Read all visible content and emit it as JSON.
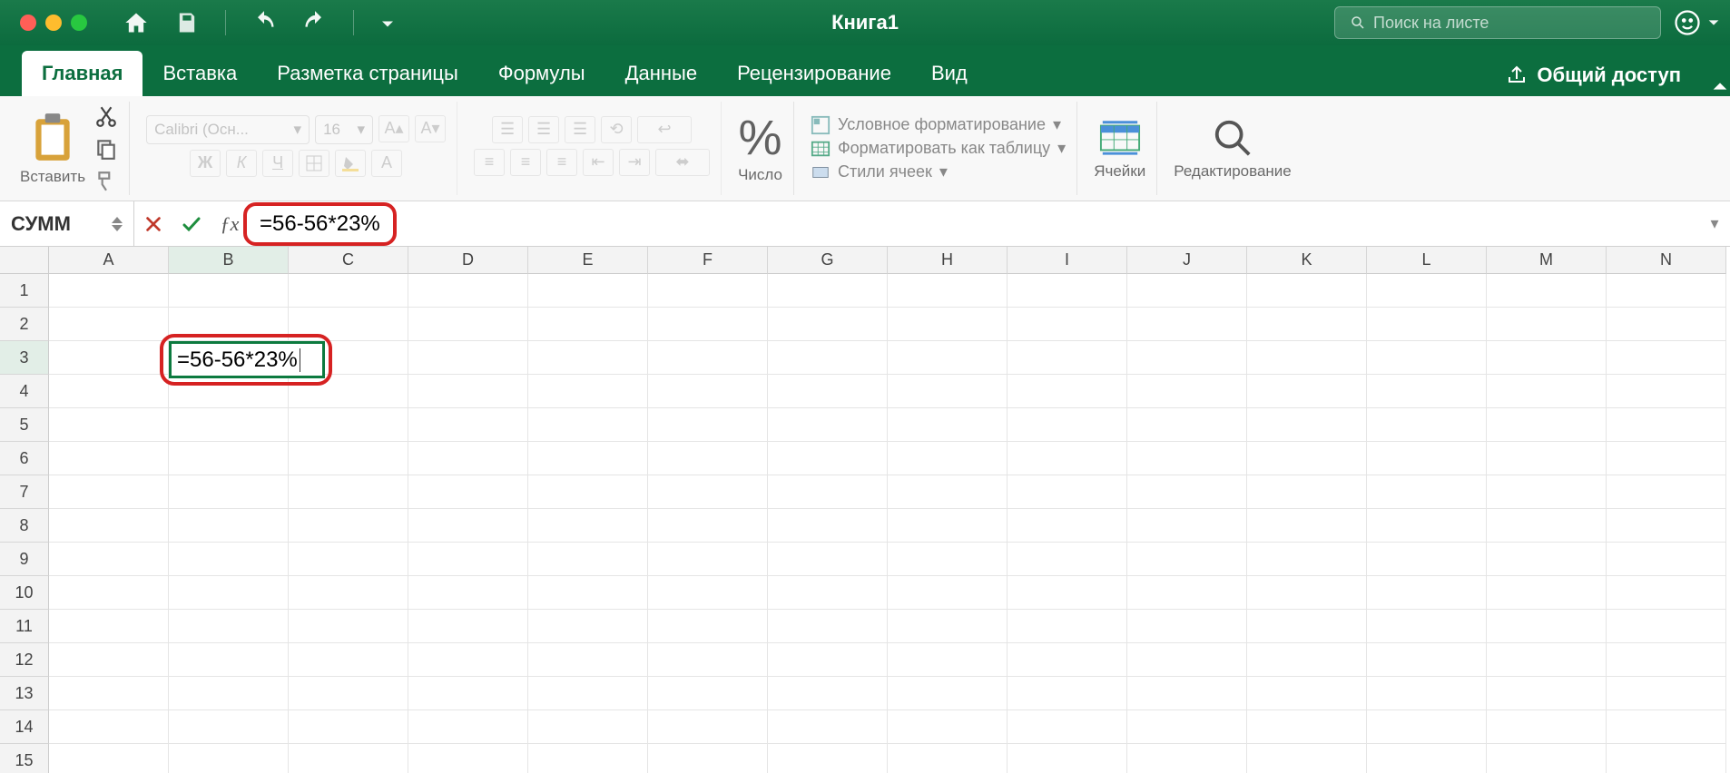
{
  "window": {
    "title": "Книга1"
  },
  "search": {
    "placeholder": "Поиск на листе"
  },
  "tabs": {
    "items": [
      "Главная",
      "Вставка",
      "Разметка страницы",
      "Формулы",
      "Данные",
      "Рецензирование",
      "Вид"
    ],
    "active": 0,
    "share": "Общий доступ"
  },
  "ribbon": {
    "paste": "Вставить",
    "font_name": "Calibri (Осн...",
    "font_size": "16",
    "bold": "Ж",
    "italic": "К",
    "underline": "Ч",
    "number_group": "Число",
    "cond_format": "Условное форматирование",
    "format_table": "Форматировать как таблицу",
    "cell_styles": "Стили ячеек",
    "cells_group": "Ячейки",
    "editing_group": "Редактирование"
  },
  "formula_bar": {
    "name_box": "СУММ",
    "formula": "=56-56*23%"
  },
  "grid": {
    "columns": [
      "A",
      "B",
      "C",
      "D",
      "E",
      "F",
      "G",
      "H",
      "I",
      "J",
      "K",
      "L",
      "M",
      "N"
    ],
    "rows": [
      "1",
      "2",
      "3",
      "4",
      "5",
      "6",
      "7",
      "8",
      "9",
      "10",
      "11",
      "12",
      "13",
      "14",
      "15"
    ],
    "active_col": 1,
    "active_row": 2,
    "active_content": "=56-56*23%"
  }
}
